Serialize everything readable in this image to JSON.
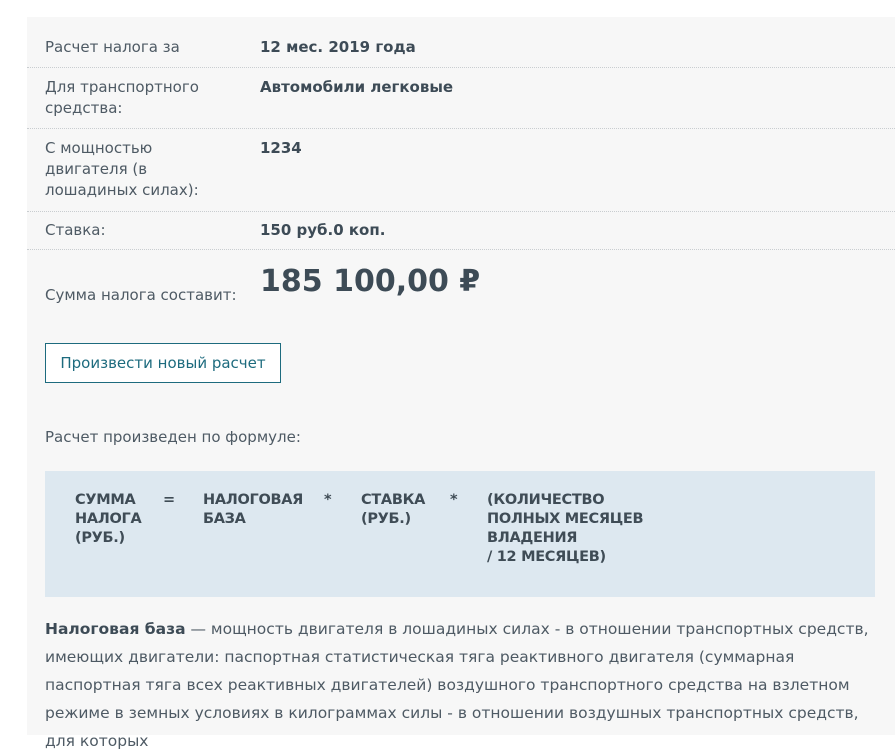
{
  "rows": [
    {
      "label": "Расчет налога за",
      "value": "12 мес. 2019 года"
    },
    {
      "label": "Для транспортного средства:",
      "value": "Автомобили легковые"
    },
    {
      "label": "С мощностью двигателя (в лошадиных силах):",
      "value": "1234"
    },
    {
      "label": "Ставка:",
      "value": "150 руб.0 коп."
    }
  ],
  "sum": {
    "label": "Сумма налога составит:",
    "value": "185 100,00 ₽"
  },
  "button": {
    "label": "Произвести новый расчет"
  },
  "formula": {
    "intro": "Расчет произведен по формуле:",
    "parts": [
      "СУММА\nНАЛОГА\n(РУБ.)",
      "=",
      "НАЛОГОВАЯ\nБАЗА",
      "*",
      "СТАВКА\n(РУБ.)",
      "*",
      "(КОЛИЧЕСТВО\nПОЛНЫХ МЕСЯЦЕВ\nВЛАДЕНИЯ\n/ 12 МЕСЯЦЕВ)"
    ]
  },
  "description": {
    "term": "Налоговая база",
    "text": " — мощность двигателя в лошадиных силах - в отношении транспортных средств, имеющих двигатели: паспортная статистическая тяга реактивного двигателя (суммарная паспортная тяга всех реактивных двигателей) воздушного транспортного средства на взлетном режиме в земных условиях в килограммах силы - в отношении воздушных транспортных средств, для которых"
  }
}
